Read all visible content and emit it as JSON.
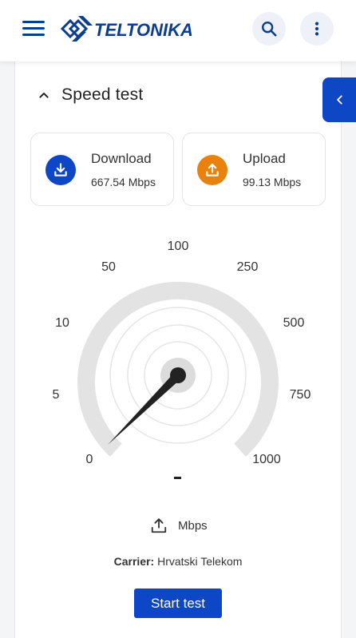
{
  "header": {
    "brand": "TELTONIKA",
    "brand_color": "#0b3d91",
    "icons": [
      "menu-icon",
      "search-icon",
      "more-vertical-icon"
    ]
  },
  "section": {
    "title": "Speed test",
    "expanded": true
  },
  "stats": {
    "download": {
      "label": "Download",
      "value": "667.54 Mbps",
      "icon": "download-icon",
      "color": "#0d47c6"
    },
    "upload": {
      "label": "Upload",
      "value": "99.13 Mbps",
      "icon": "upload-icon",
      "color": "#e8820c"
    }
  },
  "gauge": {
    "ticks": [
      "0",
      "5",
      "10",
      "50",
      "100",
      "250",
      "500",
      "750",
      "1000"
    ],
    "current_value": "-",
    "mode_icon": "upload-icon",
    "unit": "Mbps",
    "needle_at_tick": "0"
  },
  "carrier": {
    "label": "Carrier:",
    "value": "Hrvatski Telekom"
  },
  "actions": {
    "start_label": "Start test"
  },
  "colors": {
    "accent": "#0d47c6",
    "upload_accent": "#e8820c"
  }
}
